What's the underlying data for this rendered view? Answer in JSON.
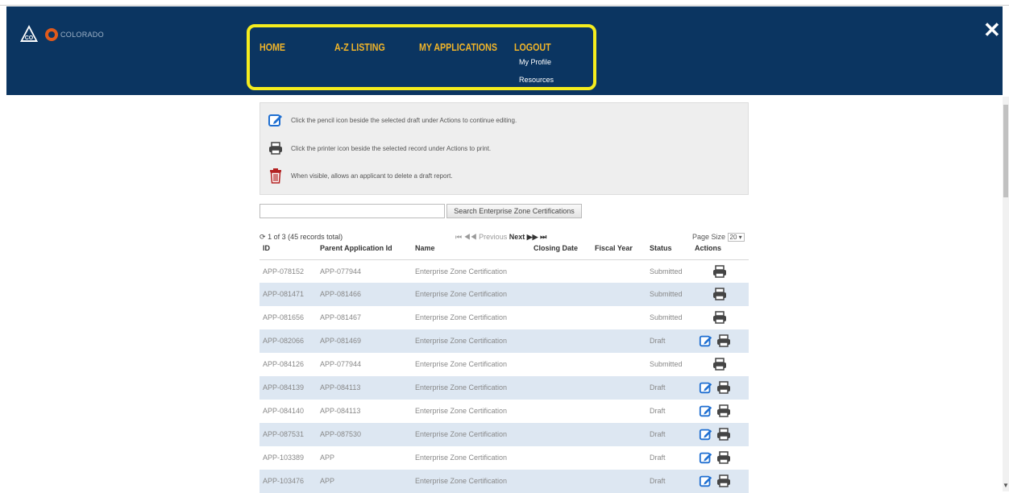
{
  "brand": {
    "wordmark": "COLORADO",
    "logo_text": "CO"
  },
  "nav": {
    "home": "HOME",
    "az": "A-Z LISTING",
    "apps": "MY APPLICATIONS",
    "logout": "LOGOUT",
    "profile": "My Profile",
    "resources": "Resources",
    "highlight_color": "#f5ed1e"
  },
  "close_label": "✕",
  "info": {
    "edit": "Click the pencil icon beside the selected draft under Actions to continue editing.",
    "print": "Click the printer icon beside the selected record under Actions to print.",
    "delete": "When visible, allows an applicant to delete a draft report."
  },
  "search": {
    "value": "",
    "placeholder": "",
    "button": "Search Enterprise Zone Certifications"
  },
  "pager": {
    "summary": "1 of 3 (45 records total)",
    "first": "⏮",
    "prev": "◀◀ Previous",
    "next": "Next",
    "next_arrows": "▶▶",
    "last": "⏭",
    "page_size_label": "Page Size",
    "page_size_value": "20"
  },
  "columns": [
    "ID",
    "Parent Application Id",
    "Name",
    "Closing Date",
    "Fiscal Year",
    "Status",
    "Actions"
  ],
  "rows": [
    {
      "id": "APP-078152",
      "parent": "APP-077944",
      "name": "Enterprise Zone Certification",
      "closing": "",
      "fiscal": "",
      "status": "Submitted",
      "edit": false
    },
    {
      "id": "APP-081471",
      "parent": "APP-081466",
      "name": "Enterprise Zone Certification",
      "closing": "",
      "fiscal": "",
      "status": "Submitted",
      "edit": false
    },
    {
      "id": "APP-081656",
      "parent": "APP-081467",
      "name": "Enterprise Zone Certification",
      "closing": "",
      "fiscal": "",
      "status": "Submitted",
      "edit": false
    },
    {
      "id": "APP-082066",
      "parent": "APP-081469",
      "name": "Enterprise Zone Certification",
      "closing": "",
      "fiscal": "",
      "status": "Draft",
      "edit": true
    },
    {
      "id": "APP-084126",
      "parent": "APP-077944",
      "name": "Enterprise Zone Certification",
      "closing": "",
      "fiscal": "",
      "status": "Submitted",
      "edit": false
    },
    {
      "id": "APP-084139",
      "parent": "APP-084113",
      "name": "Enterprise Zone Certification",
      "closing": "",
      "fiscal": "",
      "status": "Draft",
      "edit": true
    },
    {
      "id": "APP-084140",
      "parent": "APP-084113",
      "name": "Enterprise Zone Certification",
      "closing": "",
      "fiscal": "",
      "status": "Draft",
      "edit": true
    },
    {
      "id": "APP-087531",
      "parent": "APP-087530",
      "name": "Enterprise Zone Certification",
      "closing": "",
      "fiscal": "",
      "status": "Draft",
      "edit": true
    },
    {
      "id": "APP-103389",
      "parent": "APP",
      "name": "Enterprise Zone Certification",
      "closing": "",
      "fiscal": "",
      "status": "Draft",
      "edit": true
    },
    {
      "id": "APP-103476",
      "parent": "APP",
      "name": "Enterprise Zone Certification",
      "closing": "",
      "fiscal": "",
      "status": "Draft",
      "edit": true
    }
  ],
  "colors": {
    "header_bg": "#0b3561",
    "nav_text": "#f0b429",
    "alt_row": "#dde7f2",
    "edit_icon": "#1f6fd1",
    "delete_icon": "#b32020"
  }
}
